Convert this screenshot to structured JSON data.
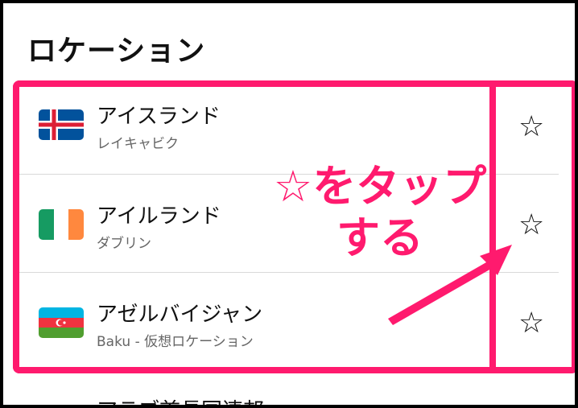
{
  "header": {
    "title": "ロケーション"
  },
  "locations": [
    {
      "name": "アイスランド",
      "sub": "レイキャビク",
      "flag": "iceland-flag-icon"
    },
    {
      "name": "アイルランド",
      "sub": "ダブリン",
      "flag": "ireland-flag-icon"
    },
    {
      "name": "アゼルバイジャン",
      "sub": "Baku - 仮想ロケーション",
      "flag": "azerbaijan-flag-icon"
    }
  ],
  "star_icon": "☆",
  "annotation": {
    "line1": "☆をタップ",
    "line2": "する",
    "color": "#ff1a6e"
  },
  "next_item": {
    "name": "アラブ首長国連邦"
  }
}
